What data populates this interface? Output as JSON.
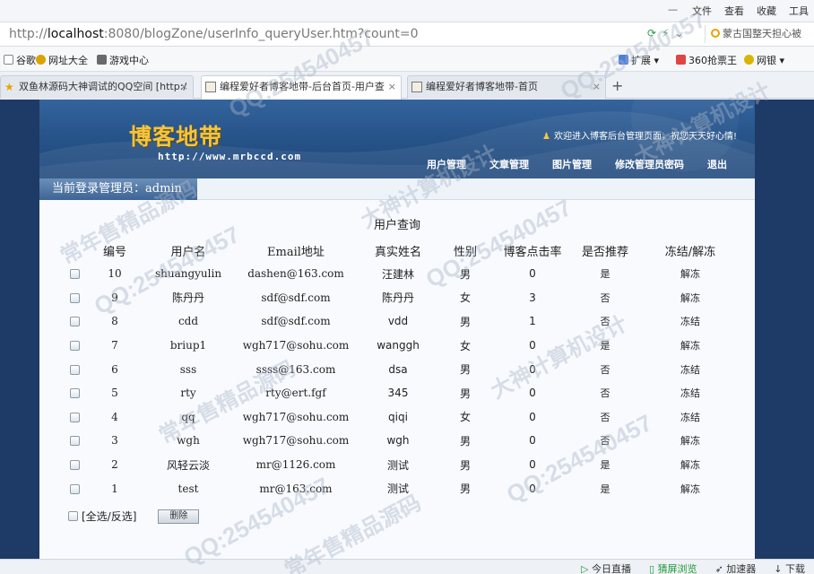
{
  "browser": {
    "menus": [
      "文件",
      "查看",
      "收藏",
      "工具"
    ],
    "url_prefix": "http://",
    "url_host": "localhost",
    "url_rest": ":8080/blogZone/userInfo_queryUser.htm?count=0",
    "search_text": "蒙古国整天担心被",
    "favorites": [
      "谷歌",
      "网址大全",
      "游戏中心",
      "扩展",
      "360抢票王",
      "网银"
    ],
    "tabs": [
      {
        "label": "双鱼林源码大神调试的QQ空间 [http:/",
        "active": false
      },
      {
        "label": "编程爱好者博客地带-后台首页-用户查",
        "active": true
      },
      {
        "label": "编程爱好者博客地带-首页",
        "active": false
      }
    ],
    "tab_new": "+",
    "tab_close": "×"
  },
  "site": {
    "logo": "博客地带",
    "logo_url": "http://www.mrbccd.com",
    "welcome": "欢迎进入博客后台管理页面，祝您天天好心情!",
    "nav": [
      "用户管理",
      "文章管理",
      "图片管理",
      "修改管理员密码",
      "退出"
    ],
    "login_label": "当前登录管理员：admin"
  },
  "content": {
    "title": "用户查询",
    "headers": [
      "编号",
      "用户名",
      "Email地址",
      "真实姓名",
      "性别",
      "博客点击率",
      "是否推荐",
      "冻结/解冻"
    ],
    "rows": [
      {
        "id": "10",
        "username": "shuangyulin",
        "email": "dashen@163.com",
        "realname": "汪建林",
        "gender": "男",
        "clicks": "0",
        "recommended": "是",
        "action": "解冻"
      },
      {
        "id": "9",
        "username": "陈丹丹",
        "email": "sdf@sdf.com",
        "realname": "陈丹丹",
        "gender": "女",
        "clicks": "3",
        "recommended": "否",
        "action": "解冻"
      },
      {
        "id": "8",
        "username": "cdd",
        "email": "sdf@sdf.com",
        "realname": "vdd",
        "gender": "男",
        "clicks": "1",
        "recommended": "否",
        "action": "冻结"
      },
      {
        "id": "7",
        "username": "briup1",
        "email": "wgh717@sohu.com",
        "realname": "wanggh",
        "gender": "女",
        "clicks": "0",
        "recommended": "是",
        "action": "解冻"
      },
      {
        "id": "6",
        "username": "sss",
        "email": "ssss@163.com",
        "realname": "dsa",
        "gender": "男",
        "clicks": "0",
        "recommended": "否",
        "action": "冻结"
      },
      {
        "id": "5",
        "username": "rty",
        "email": "rty@ert.fgf",
        "realname": "345",
        "gender": "男",
        "clicks": "0",
        "recommended": "否",
        "action": "冻结"
      },
      {
        "id": "4",
        "username": "qq",
        "email": "wgh717@sohu.com",
        "realname": "qiqi",
        "gender": "女",
        "clicks": "0",
        "recommended": "否",
        "action": "冻结"
      },
      {
        "id": "3",
        "username": "wgh",
        "email": "wgh717@sohu.com",
        "realname": "wgh",
        "gender": "男",
        "clicks": "0",
        "recommended": "否",
        "action": "解冻"
      },
      {
        "id": "2",
        "username": "风轻云淡",
        "email": "mr@1126.com",
        "realname": "测试",
        "gender": "男",
        "clicks": "0",
        "recommended": "是",
        "action": "解冻"
      },
      {
        "id": "1",
        "username": "test",
        "email": "mr@163.com",
        "realname": "测试",
        "gender": "男",
        "clicks": "0",
        "recommended": "是",
        "action": "解冻"
      }
    ],
    "select_all": "[全选/反选]",
    "delete_button": "删除"
  },
  "statusbar": [
    "今日直播",
    "猜屏浏览",
    "加速器",
    "下载"
  ],
  "watermarks": [
    "QQ:254540457",
    "常年售精品源码",
    "大神计算机设计"
  ],
  "colors": {
    "page_bg": "#1e3a66",
    "banner": "#27548a",
    "logo": "#f3c43f"
  }
}
